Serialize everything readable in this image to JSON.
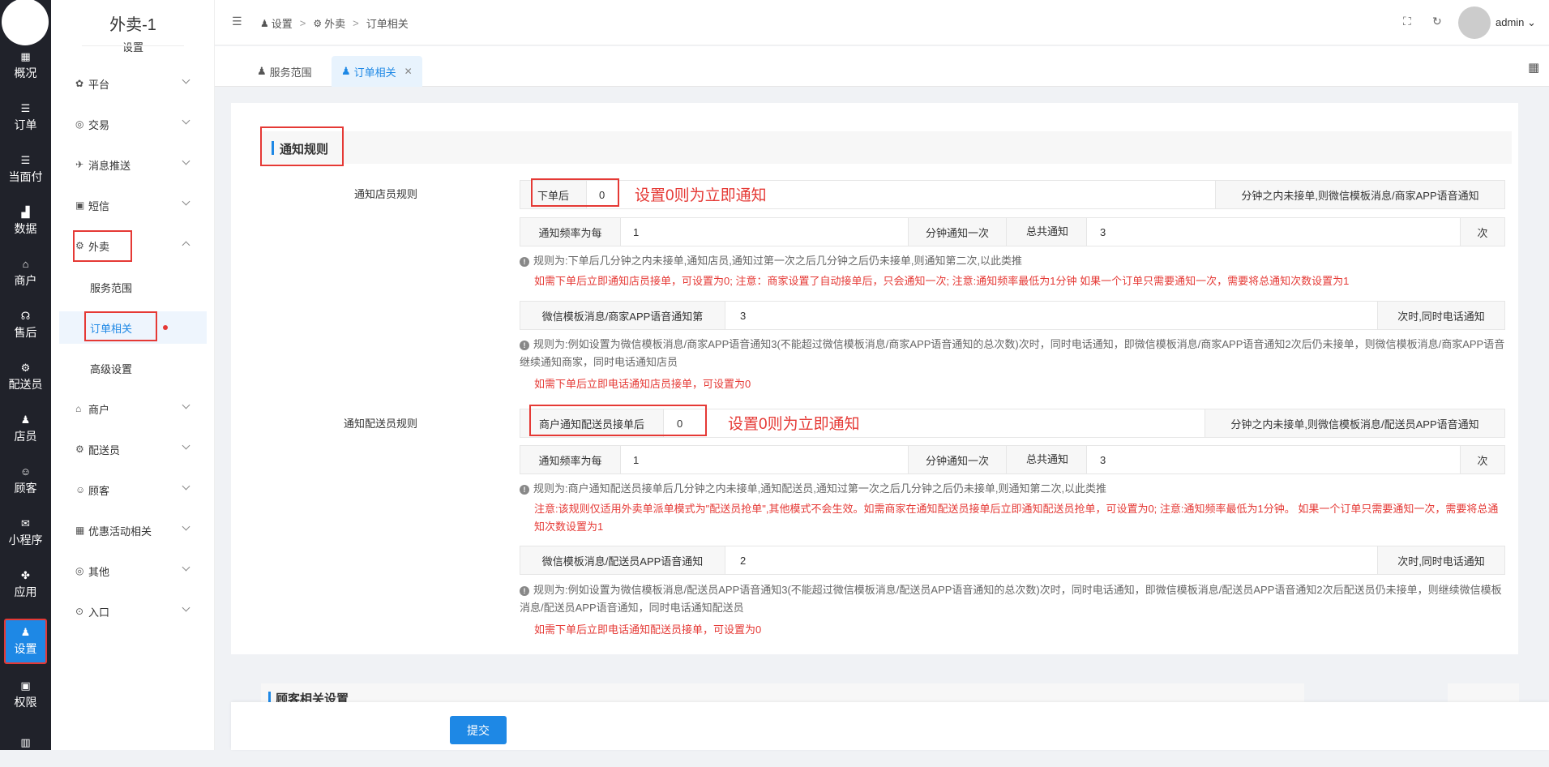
{
  "rail": {
    "items": [
      {
        "icon": "dashboard-icon",
        "glyph": "▦",
        "label": "概况"
      },
      {
        "icon": "list-icon",
        "glyph": "☰",
        "label": "订单"
      },
      {
        "icon": "list-icon",
        "glyph": "☰",
        "label": "当面付"
      },
      {
        "icon": "bar-chart-icon",
        "glyph": "▟",
        "label": "数据"
      },
      {
        "icon": "store-icon",
        "glyph": "⌂",
        "label": "商户"
      },
      {
        "icon": "headset-icon",
        "glyph": "☊",
        "label": "售后"
      },
      {
        "icon": "scooter-icon",
        "glyph": "⚙",
        "label": "配送员"
      },
      {
        "icon": "user-icon",
        "glyph": "♟",
        "label": "店员"
      },
      {
        "icon": "customer-icon",
        "glyph": "☺",
        "label": "顾客"
      },
      {
        "icon": "wechat-icon",
        "glyph": "✉",
        "label": "小程序"
      },
      {
        "icon": "apps-icon",
        "glyph": "✤",
        "label": "应用"
      },
      {
        "icon": "settings-user-icon",
        "glyph": "♟",
        "label": "设置"
      },
      {
        "icon": "lock-icon",
        "glyph": "▣",
        "label": "权限"
      },
      {
        "icon": "report-icon",
        "glyph": "▥",
        "label": ""
      }
    ]
  },
  "sidebar": {
    "title": "外卖-1",
    "subtitle": "设置",
    "menu": [
      {
        "icon": "gear-icon",
        "glyph": "✿",
        "label": "平台"
      },
      {
        "icon": "trade-icon",
        "glyph": "◎",
        "label": "交易"
      },
      {
        "icon": "push-icon",
        "glyph": "✈",
        "label": "消息推送"
      },
      {
        "icon": "sms-icon",
        "glyph": "▣",
        "label": "短信"
      },
      {
        "icon": "takeout-icon",
        "glyph": "⚙",
        "label": "外卖"
      }
    ],
    "sub": [
      "服务范围",
      "订单相关",
      "高级设置"
    ],
    "menu2": [
      {
        "icon": "store-icon",
        "glyph": "⌂",
        "label": "商户"
      },
      {
        "icon": "rider-icon",
        "glyph": "⚙",
        "label": "配送员"
      },
      {
        "icon": "customer-icon",
        "glyph": "☺",
        "label": "顾客"
      },
      {
        "icon": "gift-icon",
        "glyph": "▦",
        "label": "优惠活动相关"
      },
      {
        "icon": "other-icon",
        "glyph": "◎",
        "label": "其他"
      },
      {
        "icon": "entry-icon",
        "glyph": "⊙",
        "label": "入口"
      }
    ]
  },
  "header": {
    "breadcrumb": [
      "设置",
      "外卖",
      "订单相关"
    ],
    "user": "admin"
  },
  "tabs": [
    "服务范围",
    "订单相关"
  ],
  "section_title": "通知规则",
  "store": {
    "label": "通知店员规则",
    "after_order_prefix": "下单后",
    "after_order_value": "0",
    "after_order_suffix": "分钟之内未接单,则微信模板消息/商家APP语音通知",
    "annotation": "设置0则为立即通知",
    "freq_prefix": "通知频率为每",
    "freq_value": "1",
    "freq_suffix": "分钟通知一次",
    "total_prefix": "总共通知",
    "total_value": "3",
    "total_suffix": "次",
    "help1": "规则为:下单后几分钟之内未接单,通知店员,通知过第一次之后几分钟之后仍未接单,则通知第二次,以此类推",
    "warn1": "如需下单后立即通知店员接单，可设置为0; 注意：商家设置了自动接单后，只会通知一次; 注意:通知频率最低为1分钟 如果一个订单只需要通知一次，需要将总通知次数设置为1",
    "phone_prefix": "微信模板消息/商家APP语音通知第",
    "phone_value": "3",
    "phone_suffix": "次时,同时电话通知",
    "help2": "规则为:例如设置为微信模板消息/商家APP语音通知3(不能超过微信模板消息/商家APP语音通知的总次数)次时，同时电话通知，即微信模板消息/商家APP语音通知2次后仍未接单，则微信模板消息/商家APP语音继续通知商家，同时电话通知店员",
    "warn2": "如需下单后立即电话通知店员接单，可设置为0"
  },
  "rider": {
    "label": "通知配送员规则",
    "after_prefix": "商户通知配送员接单后",
    "after_value": "0",
    "after_suffix": "分钟之内未接单,则微信模板消息/配送员APP语音通知",
    "annotation": "设置0则为立即通知",
    "freq_prefix": "通知频率为每",
    "freq_value": "1",
    "freq_suffix": "分钟通知一次",
    "total_prefix": "总共通知",
    "total_value": "3",
    "total_suffix": "次",
    "help1": "规则为:商户通知配送员接单后几分钟之内未接单,通知配送员,通知过第一次之后几分钟之后仍未接单,则通知第二次,以此类推",
    "warn1": "注意:该规则仅适用外卖单派单模式为\"配送员抢单\",其他模式不会生效。如需商家在通知配送员接单后立即通知配送员抢单，可设置为0; 注意:通知频率最低为1分钟。 如果一个订单只需要通知一次，需要将总通知次数设置为1",
    "phone_prefix": "微信模板消息/配送员APP语音通知",
    "phone_value": "2",
    "phone_suffix": "次时,同时电话通知",
    "help2": "规则为:例如设置为微信模板消息/配送员APP语音通知3(不能超过微信模板消息/配送员APP语音通知的总次数)次时，同时电话通知，即微信模板消息/配送员APP语音通知2次后配送员仍未接单，则继续微信模板消息/配送员APP语音通知，同时电话通知配送员",
    "warn2": "如需下单后立即电话通知配送员接单，可设置为0"
  },
  "section2_title": "顾客相关设置",
  "submit_label": "提交",
  "colors": {
    "accent": "#1e88e5",
    "warn": "#e53935",
    "rail": "#20222a"
  }
}
